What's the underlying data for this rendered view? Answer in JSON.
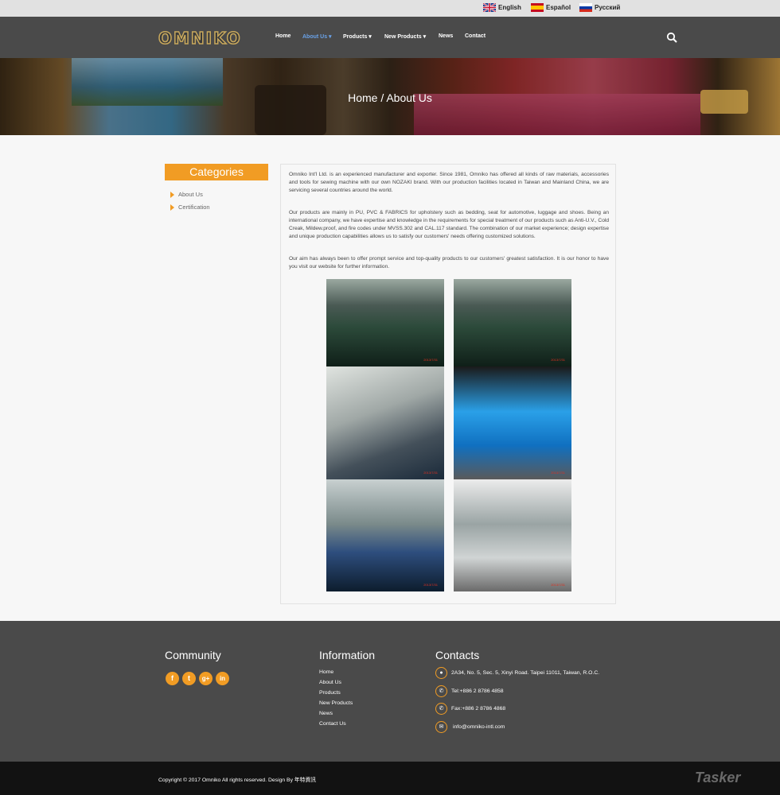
{
  "languages": [
    {
      "label": "English",
      "flag": "uk-flag-icon"
    },
    {
      "label": "Español",
      "flag": "spain-flag-icon"
    },
    {
      "label": "Русский",
      "flag": "russia-flag-icon"
    }
  ],
  "header": {
    "logo": "OMNIKO",
    "menu": [
      "Home",
      "About Us ▾",
      "Products ▾",
      "New Products ▾",
      "News",
      "Contact"
    ]
  },
  "hero": {
    "title": "Home / About Us"
  },
  "sidebar": {
    "heading": "Categories",
    "items": [
      "About Us",
      "Certification"
    ]
  },
  "main": {
    "paragraphs": [
      "Omniko Int'l Ltd. is an experienced manufacturer and exporter. Since 1981, Omniko has offered all kinds of raw materials, accessories and tools for sewing machine with our own NOZAKI brand. With our production facilities located in Taiwan and Mainland China, we are servicing several countries around the world.",
      "Our products are mainly in PU, PVC & FABRICS for upholstery such as bedding, seat for automotive, luggage and shoes. Being an international company, we have expertise and knowledge in the requirements for special treatment of our products such as Anti-U.V., Cold Creak, Mildew.proof, and fire codes under MVSS.302 and CAL.117 standard. The combination of our market experience; design expertise and unique production capabilities allows us to satisfy our customers' needs offering customized solutions.",
      "Our aim has always been to offer prompt service and top-quality products to our customers' greatest satisfaction. It is our honor to have you visit our website for further information."
    ],
    "photo_stamps": [
      "2013/7/31",
      "2013/7/31",
      "2013/7/31",
      "2013/7/31",
      "2013/7/31",
      "2013/7/31"
    ]
  },
  "footer": {
    "community": {
      "heading": "Community",
      "icons": [
        "facebook-icon",
        "twitter-icon",
        "google-plus-icon",
        "linkedin-icon"
      ],
      "glyphs": [
        "f",
        "t",
        "g+",
        "in"
      ]
    },
    "information": {
      "heading": "Information",
      "links": [
        "Home",
        "About Us",
        "Products",
        "New Products",
        "News",
        "Contact Us"
      ]
    },
    "contacts": {
      "heading": "Contacts",
      "address": "2A34, No. 5, Sec. 5, Xinyi Road. Taipei 11011, Taiwan, R.O.C.",
      "tel": "Tel:+886 2 8786 4858",
      "fax": "Fax:+886 2 8786 4868",
      "email": "info@omniko-intl.com"
    },
    "copyright": "Copyright © 2017 Omniko All rights reserved. Design By 年特資訊",
    "watermark": "Tasker"
  },
  "colors": {
    "accent": "#f19c24",
    "nav": "#4a4a4a",
    "active_menu": "#6aa2e8",
    "footer": "#4a4a4a",
    "bottom_bar": "#121212"
  }
}
